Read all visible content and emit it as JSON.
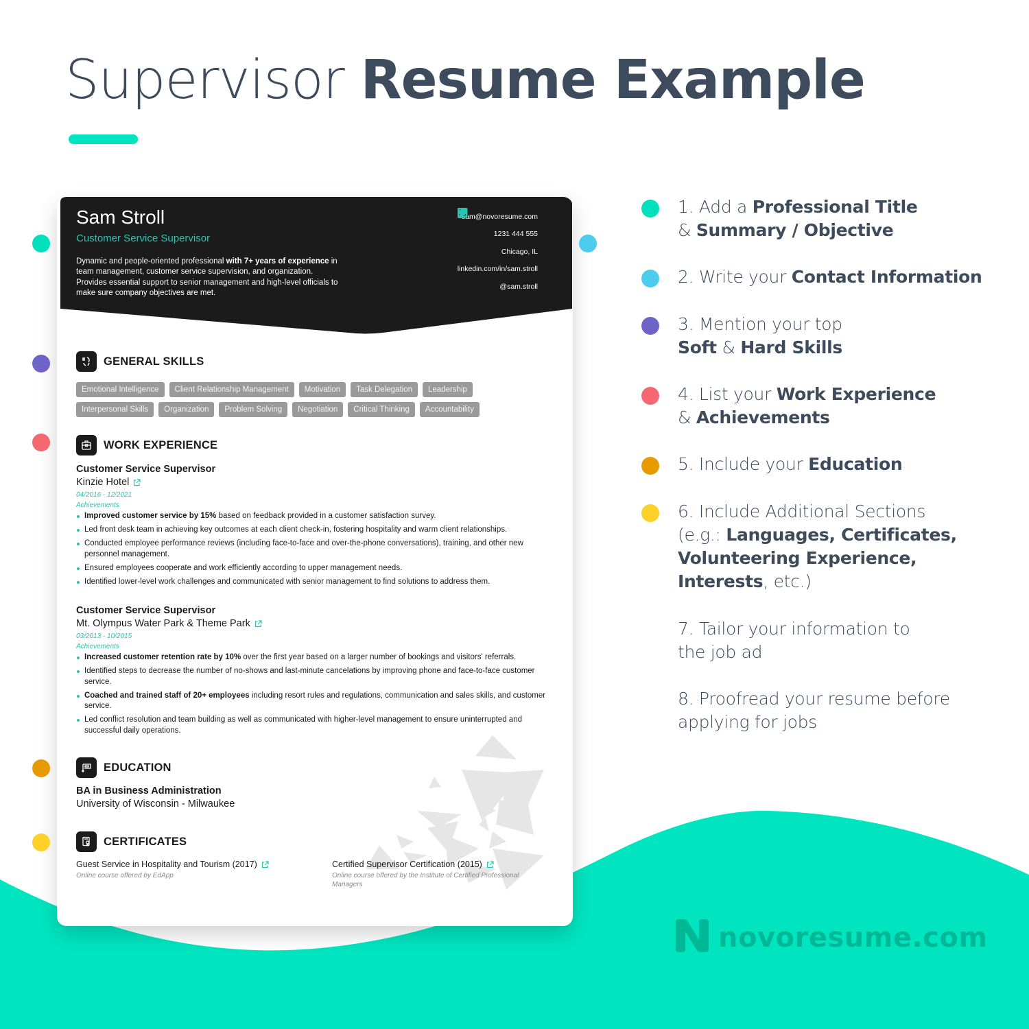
{
  "page": {
    "title_light": "Supervisor",
    "title_bold": "Resume Example",
    "accent_color": "#00e5c0"
  },
  "resume": {
    "name": "Sam Stroll",
    "title": "Customer Service Supervisor",
    "summary": {
      "part1": "Dynamic and people-oriented professional ",
      "bold1": "with 7+ years of experience",
      "part2": " in team management, customer service supervision, and organization. Provides essential support to senior management and high-level officials to make sure company objectives are met."
    },
    "contacts": [
      {
        "value": "sam@novoresume.com",
        "icon": "envelope-icon"
      },
      {
        "value": "1231 444 555",
        "icon": "phone-icon"
      },
      {
        "value": "Chicago, IL",
        "icon": "location-pin-icon"
      },
      {
        "value": "linkedin.com/in/sam.stroll",
        "icon": "linkedin-icon"
      },
      {
        "value": "@sam.stroll",
        "icon": "twitter-icon"
      }
    ],
    "sections": {
      "skills": "GENERAL SKILLS",
      "work": "WORK EXPERIENCE",
      "education": "EDUCATION",
      "certificates": "CERTIFICATES"
    },
    "skills_rows": [
      [
        "Emotional Intelligence",
        "Client Relationship Management",
        "Motivation",
        "Task Delegation",
        "Leadership"
      ],
      [
        "Interpersonal Skills",
        "Organization",
        "Problem Solving",
        "Negotiation",
        "Critical Thinking",
        "Accountability"
      ]
    ],
    "jobs": [
      {
        "title": "Customer Service Supervisor",
        "company": "Kinzie Hotel",
        "dates": "04/2016 - 12/2021",
        "achievements_label": "Achievements",
        "bullets": [
          {
            "bold": "Improved customer service by 15%",
            "text": " based on feedback provided in a customer satisfaction survey."
          },
          {
            "bold": "",
            "text": "Led front desk team in achieving key outcomes at each client check-in, fostering hospitality and warm client relationships."
          },
          {
            "bold": "",
            "text": "Conducted employee performance reviews (including face-to-face and over-the-phone conversations), training, and other new personnel management."
          },
          {
            "bold": "",
            "text": "Ensured employees cooperate and work efficiently according to upper management needs."
          },
          {
            "bold": "",
            "text": "Identified lower-level work challenges and communicated with senior management to find solutions to address them."
          }
        ]
      },
      {
        "title": "Customer Service Supervisor",
        "company": "Mt. Olympus Water Park & Theme Park",
        "dates": "03/2013 - 10/2015",
        "achievements_label": "Achievements",
        "bullets": [
          {
            "bold": "Increased customer retention rate by 10%",
            "text": " over the first year based on a larger number of bookings and visitors' referrals."
          },
          {
            "bold": "",
            "text": "Identified steps to decrease the number of no-shows and last-minute cancelations by improving phone and face-to-face customer service."
          },
          {
            "bold": "Coached and trained staff of 20+ employees",
            "text": " including resort rules and regulations, communication and sales skills, and customer service."
          },
          {
            "bold": "",
            "text": "Led conflict resolution and team building as well as communicated with higher-level management to ensure uninterrupted and successful daily operations."
          }
        ]
      }
    ],
    "education": {
      "degree": "BA in Business Administration",
      "school": "University of Wisconsin - Milwaukee"
    },
    "certificates": [
      {
        "name": "Guest Service in Hospitality and Tourism (2017)",
        "desc": "Online course offered by EdApp"
      },
      {
        "name": "Certified Supervisor Certification (2015)",
        "desc": "Online course offered by the Institute of Certified Professional Managers"
      }
    ]
  },
  "tips": [
    {
      "color": "#00e0bd",
      "lines": [
        [
          {
            "t": "1. Add a "
          },
          {
            "b": "Professional Title"
          }
        ],
        [
          {
            "t": "& "
          },
          {
            "b": "Summary / Objective"
          }
        ]
      ]
    },
    {
      "color": "#4dcdee",
      "lines": [
        [
          {
            "t": "2. Write your "
          },
          {
            "b": "Contact Information"
          }
        ]
      ]
    },
    {
      "color": "#6e63c6",
      "lines": [
        [
          {
            "t": "3. Mention your top"
          }
        ],
        [
          {
            "b": "Soft"
          },
          {
            "t": " & "
          },
          {
            "b": "Hard Skills"
          }
        ]
      ]
    },
    {
      "color": "#f5686f",
      "lines": [
        [
          {
            "t": "4. List your "
          },
          {
            "b": "Work Experience"
          }
        ],
        [
          {
            "t": "& "
          },
          {
            "b": "Achievements"
          }
        ]
      ]
    },
    {
      "color": "#e69a00",
      "lines": [
        [
          {
            "t": "5. Include your "
          },
          {
            "b": "Education"
          }
        ]
      ]
    },
    {
      "color": "#fdd02a",
      "lines": [
        [
          {
            "t": "6. Include Additional Sections"
          }
        ],
        [
          {
            "t": "(e.g.: "
          },
          {
            "b": "Languages, Certificates,"
          }
        ],
        [
          {
            "b": "Volunteering Experience,"
          }
        ],
        [
          {
            "b": "Interests"
          },
          {
            "t": ", etc.)"
          }
        ]
      ]
    },
    {
      "color": "",
      "lines": [
        [
          {
            "t": "7. Tailor your information to"
          }
        ],
        [
          {
            "t": "the job ad"
          }
        ]
      ]
    },
    {
      "color": "",
      "lines": [
        [
          {
            "t": "8. Proofread your resume before"
          }
        ],
        [
          {
            "t": "applying for jobs"
          }
        ]
      ]
    }
  ],
  "left_dots": [
    {
      "color": "#00e0bd",
      "for": "title-summary"
    },
    {
      "color": "#4dcdee",
      "for": "contact-information"
    },
    {
      "color": "#6e63c6",
      "for": "skills"
    },
    {
      "color": "#f5686f",
      "for": "work-experience"
    },
    {
      "color": "#e69a00",
      "for": "education"
    },
    {
      "color": "#fdd02a",
      "for": "certificates"
    }
  ],
  "brand": {
    "name": "novoresume.com",
    "color": "#00b895"
  }
}
